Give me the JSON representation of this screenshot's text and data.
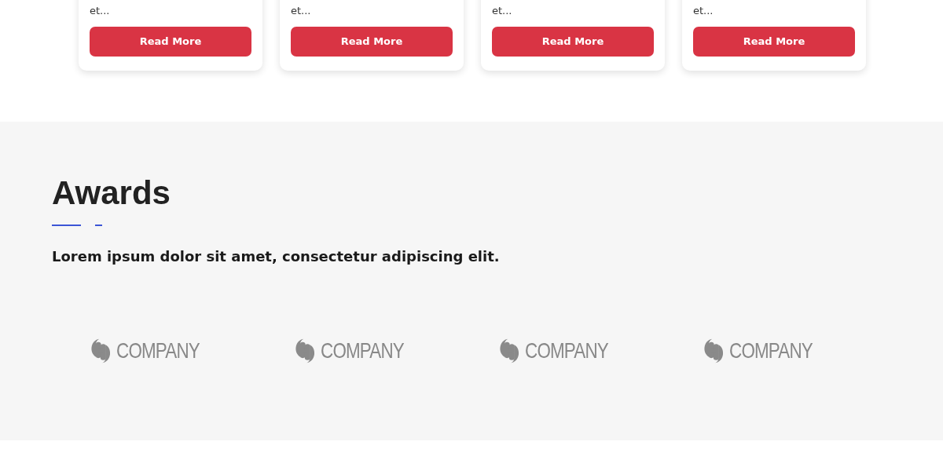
{
  "cards": [
    {
      "text": "et...",
      "button": "Read More"
    },
    {
      "text": "et...",
      "button": "Read More"
    },
    {
      "text": "et...",
      "button": "Read More"
    },
    {
      "text": "et...",
      "button": "Read More"
    }
  ],
  "awards": {
    "title": "Awards",
    "description": "Lorem ipsum dolor sit amet, consectetur adipiscing elit.",
    "logos": [
      {
        "name": "COMPANY"
      },
      {
        "name": "COMPANY"
      },
      {
        "name": "COMPANY"
      },
      {
        "name": "COMPANY"
      }
    ]
  }
}
